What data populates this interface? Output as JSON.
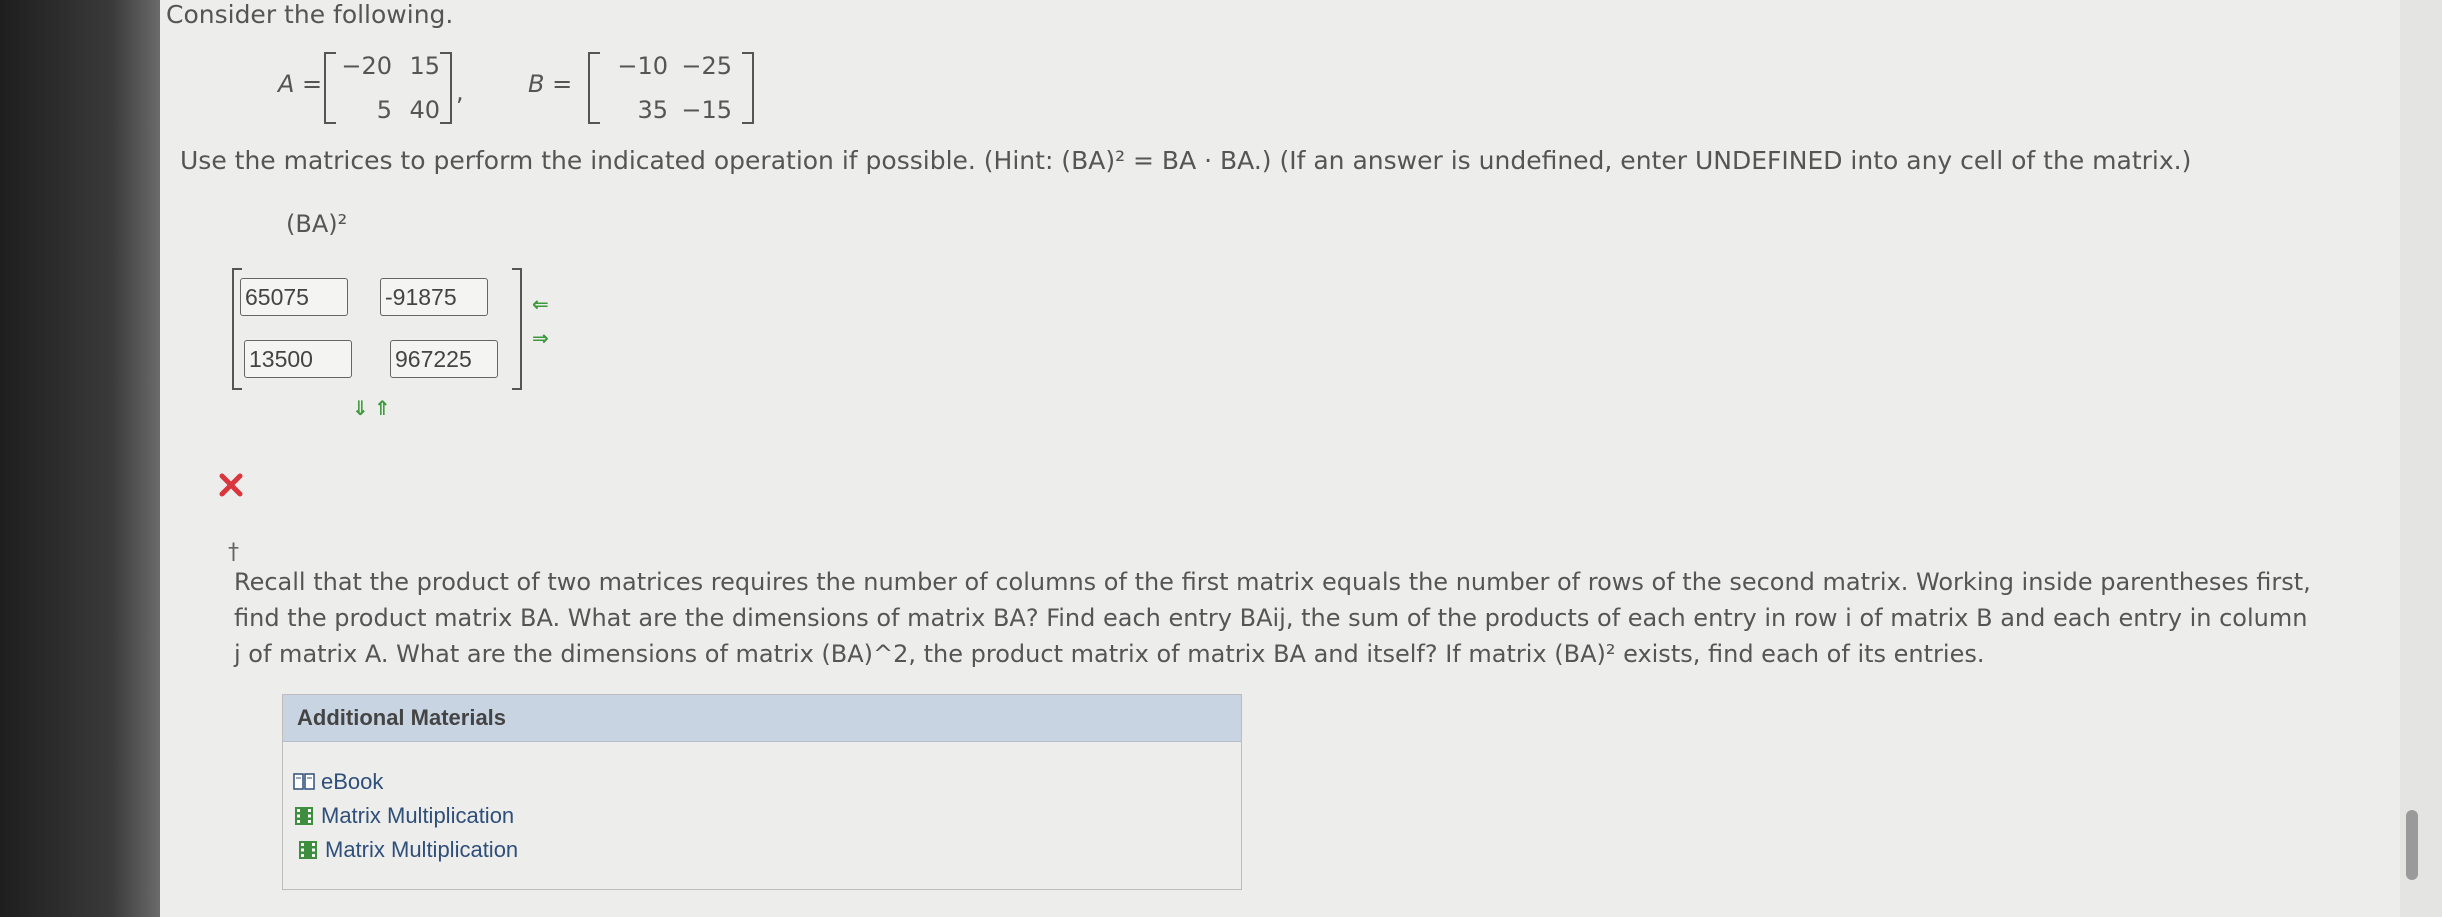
{
  "prompt": "Consider the following.",
  "matrix_a": {
    "label": "A =",
    "rows": [
      [
        "−20",
        "15"
      ],
      [
        "5",
        "40"
      ]
    ]
  },
  "matrix_b": {
    "label": "B =",
    "rows": [
      [
        "−10",
        "−25"
      ],
      [
        "35",
        "−15"
      ]
    ]
  },
  "separator": ",",
  "instructions": "Use the matrices to perform the indicated operation if possible. (Hint:  (BA)² = BA · BA.)  (If an answer is undefined, enter UNDEFINED into any cell of the matrix.)",
  "operation_label": "(BA)²",
  "answer": {
    "cells": [
      "65075",
      "-91875",
      "13500",
      "967225"
    ]
  },
  "result": {
    "status": "incorrect",
    "color": "#d9363e"
  },
  "hint": {
    "marker": "†",
    "lines": [
      "Recall that the product of two matrices requires the number of columns of the first matrix equals the number of rows of the second matrix. Working inside parentheses first,",
      "find the product matrix BA. What are the dimensions of matrix BA? Find each entry  BAij,  the sum of the products of each entry in row i of matrix B and each entry in column",
      "j of matrix A. What are the dimensions of matrix (BA)^2, the product matrix of matrix BA and itself? If matrix  (BA)²  exists, find each of its entries."
    ]
  },
  "additional_materials": {
    "header": "Additional Materials",
    "items": [
      {
        "label": "eBook",
        "icon": "book-icon"
      },
      {
        "label": "Matrix Multiplication",
        "icon": "film-icon"
      },
      {
        "label": "Matrix Multiplication",
        "icon": "film-icon"
      }
    ]
  },
  "colors": {
    "accent_green": "#3c9a3c",
    "link": "#2f4f7a",
    "header_bg": "#c9d4e3"
  }
}
